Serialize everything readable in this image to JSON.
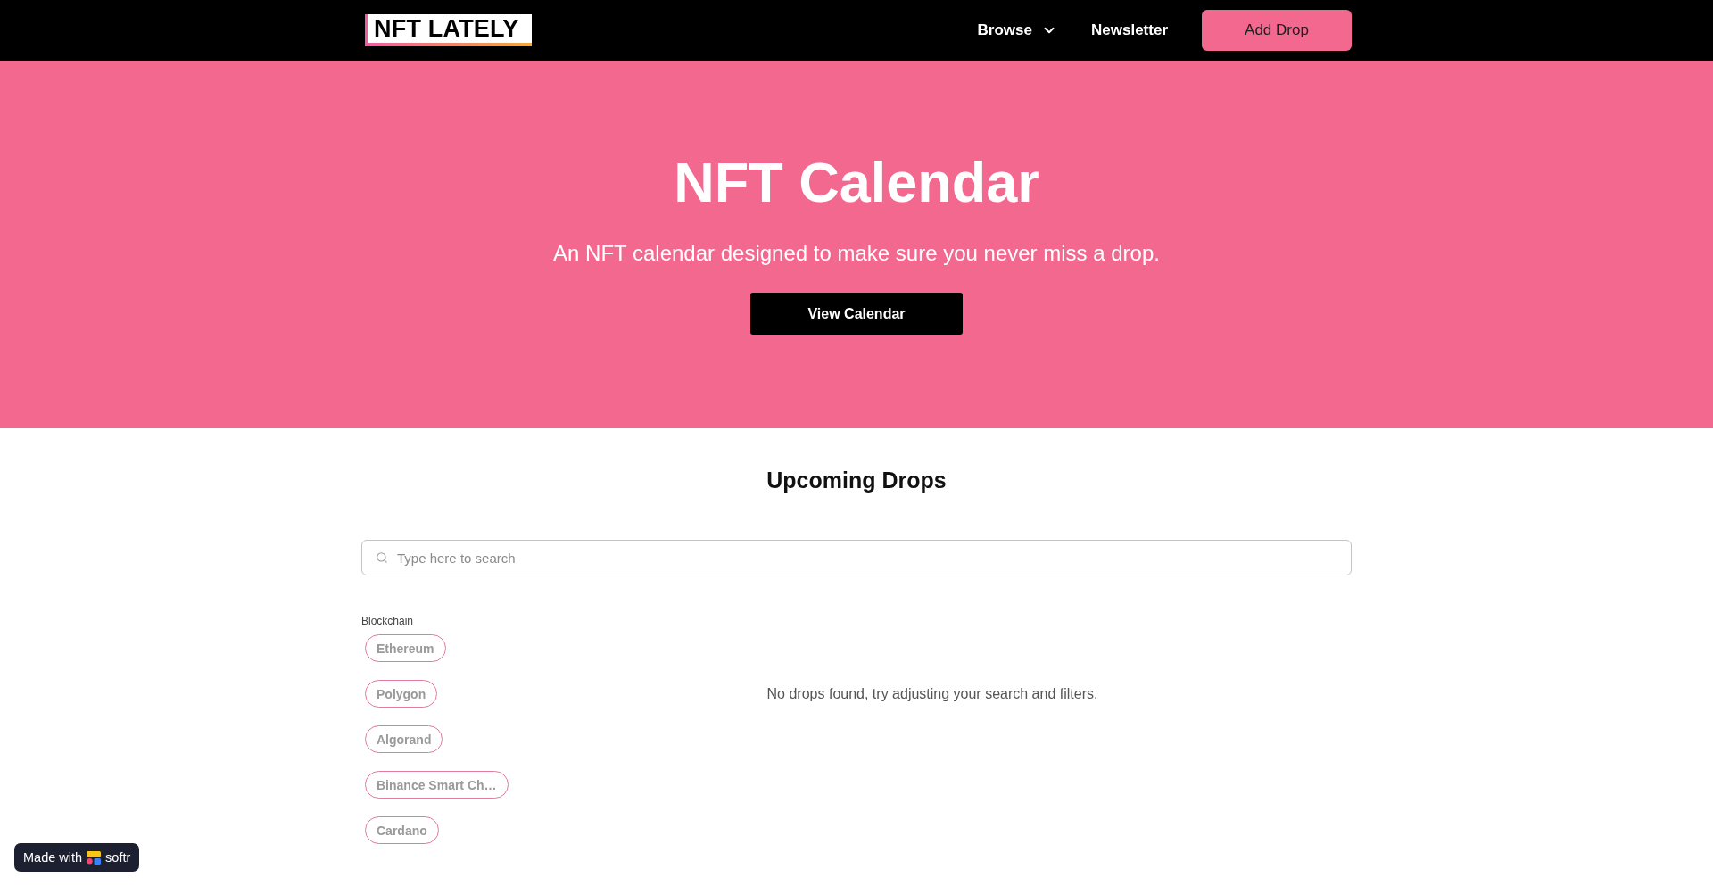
{
  "header": {
    "logo": "NFT LATELY",
    "nav": [
      {
        "label": "Browse",
        "kind": "dropdown"
      },
      {
        "label": "Newsletter",
        "kind": "link"
      }
    ],
    "cta": "Add Drop"
  },
  "hero": {
    "title": "NFT Calendar",
    "subtitle": "An NFT calendar designed to make sure you never miss a drop.",
    "button": "View Calendar"
  },
  "drops": {
    "title": "Upcoming Drops",
    "search": {
      "placeholder": "Type here to search"
    },
    "filters": [
      {
        "label": "Blockchain",
        "options": [
          {
            "label": "Ethereum",
            "selected": false
          },
          {
            "label": "Polygon",
            "selected": false
          },
          {
            "label": "Algorand",
            "selected": false
          },
          {
            "label": "Binance Smart Ch…",
            "selected": false
          },
          {
            "label": "Cardano",
            "selected": false
          }
        ]
      }
    ],
    "empty_message": "No drops found, try adjusting your search and filters."
  },
  "badge": {
    "prefix": "Made with",
    "brand": "softr"
  }
}
